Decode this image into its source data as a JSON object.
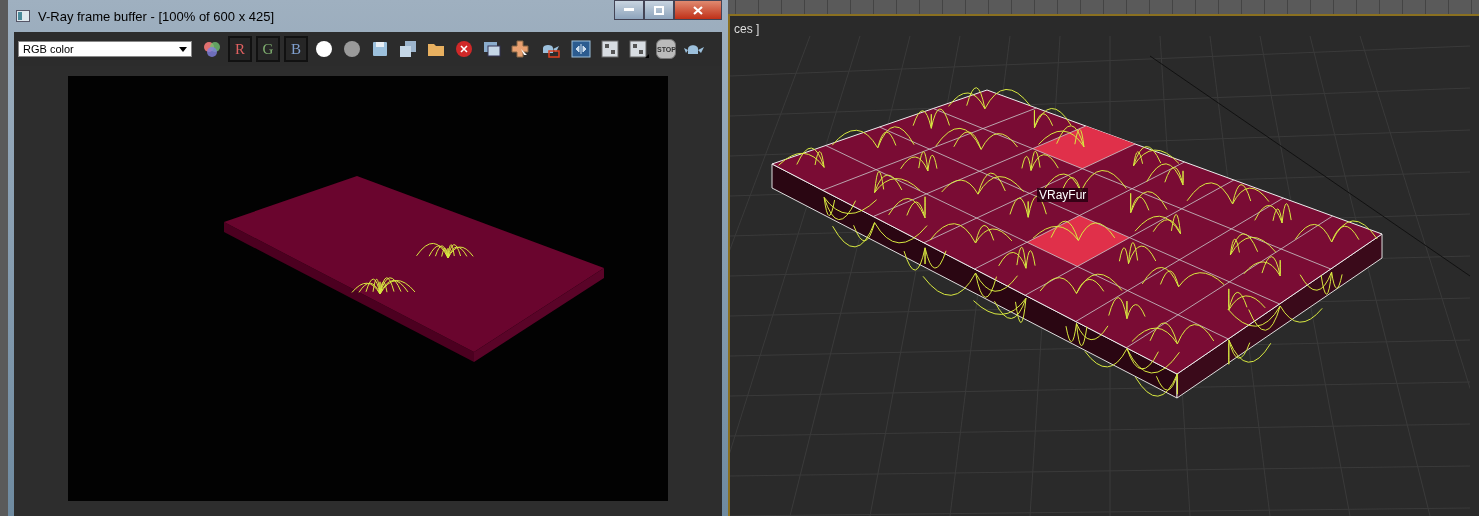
{
  "viewport": {
    "label": "ces ]",
    "object_label": "VRayFur"
  },
  "frame_buffer": {
    "title": "V-Ray frame buffer - [100% of 600 x 425]",
    "channel_select": {
      "value": "RGB color"
    },
    "channels": [
      {
        "label": "R",
        "on": true,
        "color": "#e06060"
      },
      {
        "label": "G",
        "on": true,
        "color": "#80b070"
      },
      {
        "label": "B",
        "on": true,
        "color": "#80a0d0"
      }
    ],
    "stop_button": "STOP"
  }
}
